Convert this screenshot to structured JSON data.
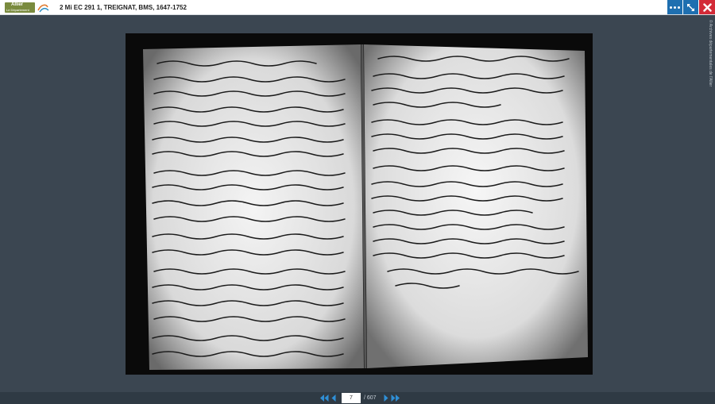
{
  "header": {
    "logo_line1": "Allier",
    "logo_line2": "Le Département",
    "title": "2 Mi EC 291 1, TREIGNAT, BMS, 1647-1752"
  },
  "toolbar": {
    "more_icon": "more-dots-icon",
    "fullscreen_icon": "expand-icon",
    "close_icon": "close-icon"
  },
  "colors": {
    "background": "#3b4651",
    "accent_blue": "#1e6fb0",
    "close_red": "#d32a37",
    "logo_green": "#7a8b3e"
  },
  "viewer": {
    "image_description": "scanned manuscript register pages"
  },
  "copyright": "© Archives départementales de l'Allier",
  "pager": {
    "current_page": "7",
    "total_pages": "/ 607"
  }
}
